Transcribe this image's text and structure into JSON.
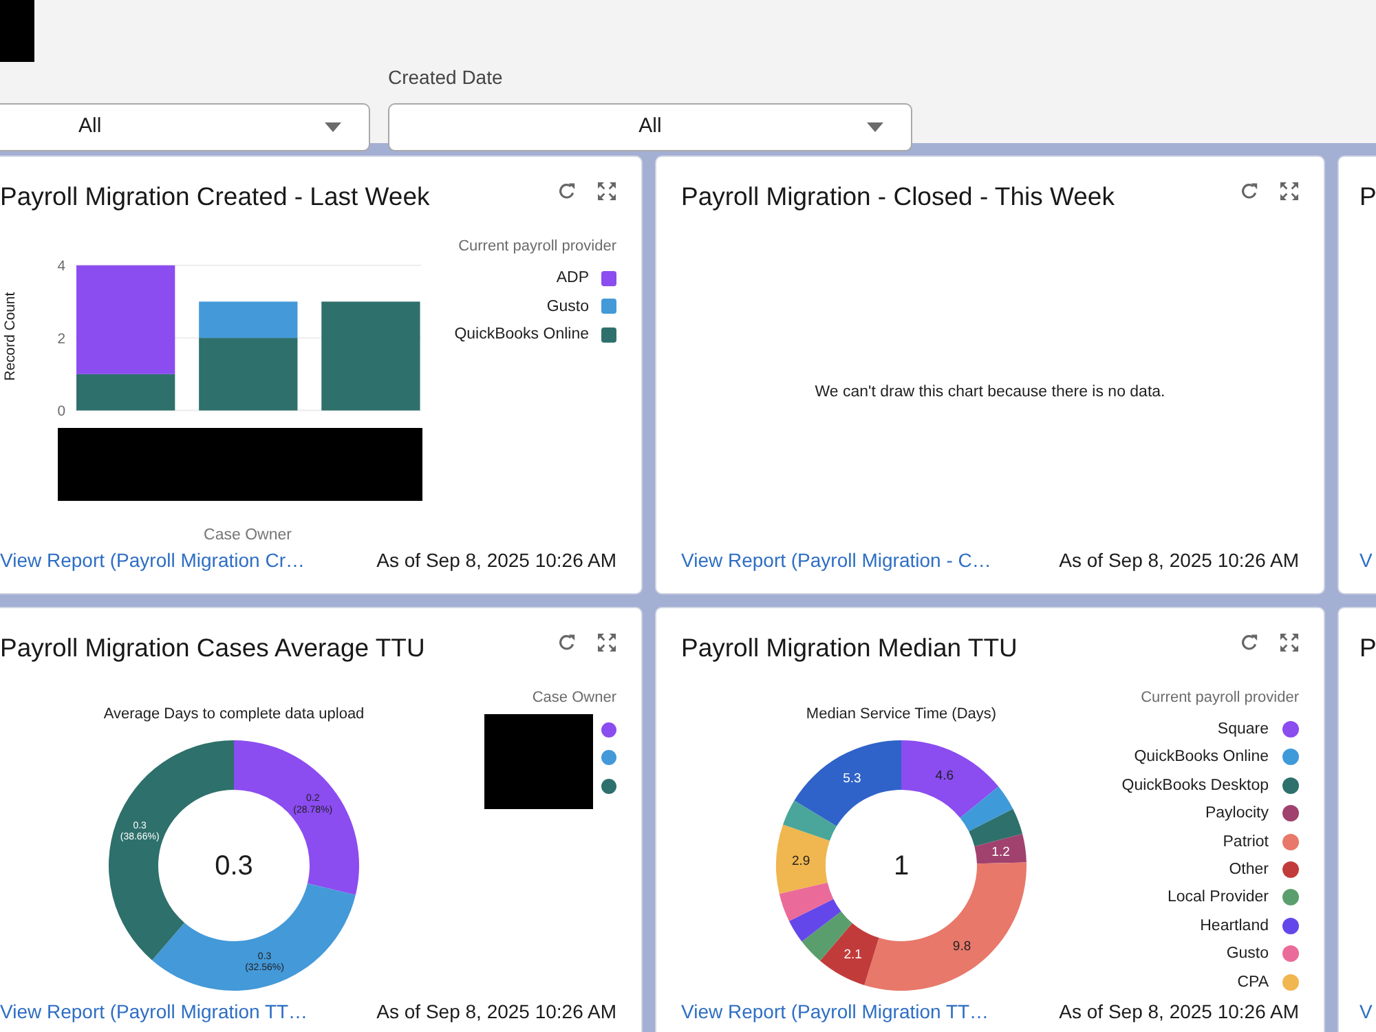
{
  "filters": [
    {
      "value": "All"
    },
    {
      "label": "Created Date",
      "value": "All"
    }
  ],
  "cards": [
    {
      "kind": "chart",
      "title": "Payroll Migration Created - Last Week",
      "legend_title": "Current payroll provider",
      "chart_data": {
        "type": "bar",
        "ylabel": "Record Count",
        "xlabel": "Case Owner",
        "ylim": [
          0,
          4
        ],
        "yticks": [
          0,
          2,
          4
        ],
        "stacked": true,
        "series": [
          {
            "name": "ADP",
            "color": "#8b4cf0",
            "values": [
              3,
              0,
              0
            ]
          },
          {
            "name": "Gusto",
            "color": "#4499d8",
            "values": [
              0,
              1,
              0
            ]
          },
          {
            "name": "QuickBooks Online",
            "color": "#2e706b",
            "values": [
              1,
              2,
              3
            ]
          }
        ]
      },
      "link": "View Report (Payroll Migration Cr…",
      "timestamp": "As of Sep 8, 2025 10:26 AM"
    },
    {
      "kind": "empty",
      "title": "Payroll Migration - Closed - This Week",
      "message": "We can't draw this chart because there is no data.",
      "link": "View Report (Payroll Migration - C…",
      "timestamp": "As of Sep 8, 2025 10:26 AM"
    },
    {
      "kind": "partial",
      "title": "P",
      "link": "V"
    },
    {
      "kind": "chart",
      "title": "Payroll Migration Cases Average TTU",
      "legend_title": "Case Owner",
      "chart_data": {
        "type": "donut",
        "title": "Average Days to complete data upload",
        "values": [
          28.78,
          32.56,
          38.66
        ],
        "colors": [
          "#8b4cf0",
          "#4499d8",
          "#2e706b"
        ],
        "value_labels": [
          [
            "0.2",
            "(28.78%)"
          ],
          [
            "0.3",
            "(32.56%)"
          ],
          [
            "0.3",
            "(38.66%)"
          ]
        ],
        "annotations": [
          {
            "text": "0.3"
          }
        ]
      },
      "link": "View Report (Payroll Migration TT…",
      "timestamp": "As of Sep 8, 2025 10:26 AM"
    },
    {
      "kind": "chart",
      "title": "Payroll Migration Median TTU",
      "legend_title": "Current payroll provider",
      "chart_data": {
        "type": "donut",
        "title": "Median Service Time (Days)",
        "categories": [
          "Square",
          "QuickBooks Online",
          "QuickBooks Desktop",
          "Paylocity",
          "Patriot",
          "Other",
          "Local Provider",
          "Heartland",
          "Gusto",
          "CPA",
          null,
          null
        ],
        "values": [
          4.6,
          1.1,
          1.1,
          1.2,
          9.8,
          2.1,
          1.1,
          1.0,
          1.2,
          2.9,
          1.1,
          5.3
        ],
        "colors": [
          "#8b4cf0",
          "#3f9ad9",
          "#2e706b",
          "#a0426d",
          "#e8786a",
          "#c23b3b",
          "#5b9e6e",
          "#6447ea",
          "#ea6b99",
          "#f0b64f",
          "#4aa69a",
          "#2f63c9"
        ],
        "value_labels": [
          "4.6",
          null,
          null,
          "1.2",
          "9.8",
          "2.1",
          null,
          null,
          null,
          "2.9",
          null,
          "5.3"
        ],
        "annotations": [
          {
            "text": "1"
          }
        ]
      },
      "link": "View Report (Payroll Migration TT…",
      "timestamp": "As of Sep 8, 2025 10:26 AM"
    },
    {
      "kind": "partial",
      "title": "P",
      "link": "V"
    }
  ]
}
